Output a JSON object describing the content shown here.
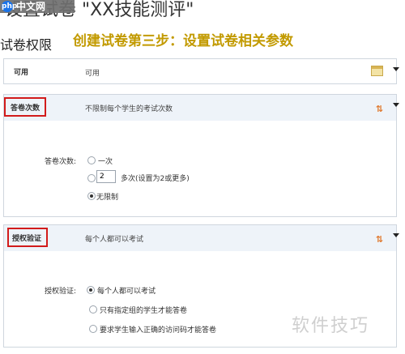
{
  "header": {
    "badge_logo": "php",
    "badge_text": "中文网",
    "title": "设置试卷 \"XX技能测评\"",
    "section_title": "试卷权限",
    "step_banner": "创建试卷第三步：设置试卷相关参数"
  },
  "rows": {
    "availability": {
      "label": "可用",
      "value": "可用",
      "icon": "calendar-icon"
    },
    "attempts": {
      "label": "答卷次数",
      "value": "不限制每个学生的考试次数",
      "icon": "sort-icon",
      "icon_glyph": "⇅"
    },
    "access": {
      "label": "授权验证",
      "value": "每个人都可以考试",
      "icon": "sort-icon",
      "icon_glyph": "⇅"
    }
  },
  "attempts_form": {
    "label": "答卷次数:",
    "options": [
      "一次",
      "多次(设置为2或更多)",
      "无限制"
    ],
    "count_value": "2",
    "selected": "无限制"
  },
  "access_form": {
    "label": "授权验证:",
    "options": [
      "每个人都可以考试",
      "只有指定组的学生才能答卷",
      "要求学生输入正确的访问码才能答卷"
    ],
    "selected": "每个人都可以考试"
  },
  "watermark": "软件技巧",
  "colors": {
    "highlight": "#d21b1b",
    "banner": "#c29a00",
    "row_blue": "#eef3f9"
  }
}
